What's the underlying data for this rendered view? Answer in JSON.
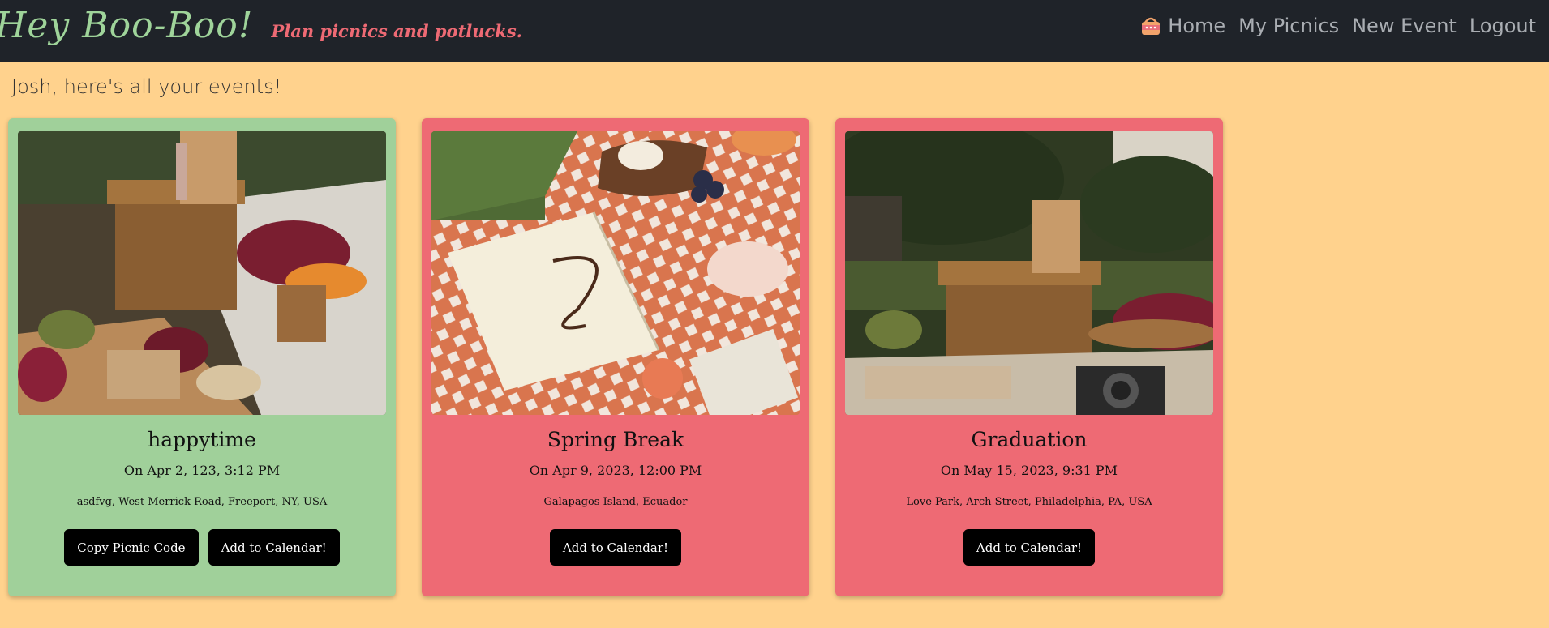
{
  "nav": {
    "brand": "Hey Boo-Boo!",
    "tagline": "Plan picnics and potlucks.",
    "links": [
      {
        "label": "Home",
        "icon": "picnic-basket-icon"
      },
      {
        "label": "My Picnics"
      },
      {
        "label": "New Event"
      },
      {
        "label": "Logout"
      }
    ]
  },
  "page": {
    "heading": "Josh, here's all your events!"
  },
  "events": [
    {
      "title": "happytime",
      "date": "On Apr 2, 123, 3:12 PM",
      "address": "asdfvg, West Merrick Road, Freeport, NY, USA",
      "color": "#a0d09a",
      "image": "picnic-basket-charcuterie-photo",
      "buttons": [
        "Copy Picnic Code",
        "Add to Calendar!"
      ]
    },
    {
      "title": "Spring Break",
      "date": "On Apr 9, 2023, 12:00 PM",
      "address": "Galapagos Island, Ecuador",
      "color": "#ee6a74",
      "image": "picnic-blanket-notebook-photo",
      "buttons": [
        "Add to Calendar!"
      ]
    },
    {
      "title": "Graduation",
      "date": "On May 15, 2023, 9:31 PM",
      "address": "Love Park, Arch Street, Philadelphia, PA, USA",
      "color": "#ee6a74",
      "image": "park-picnic-camera-photo",
      "buttons": [
        "Add to Calendar!"
      ]
    }
  ]
}
